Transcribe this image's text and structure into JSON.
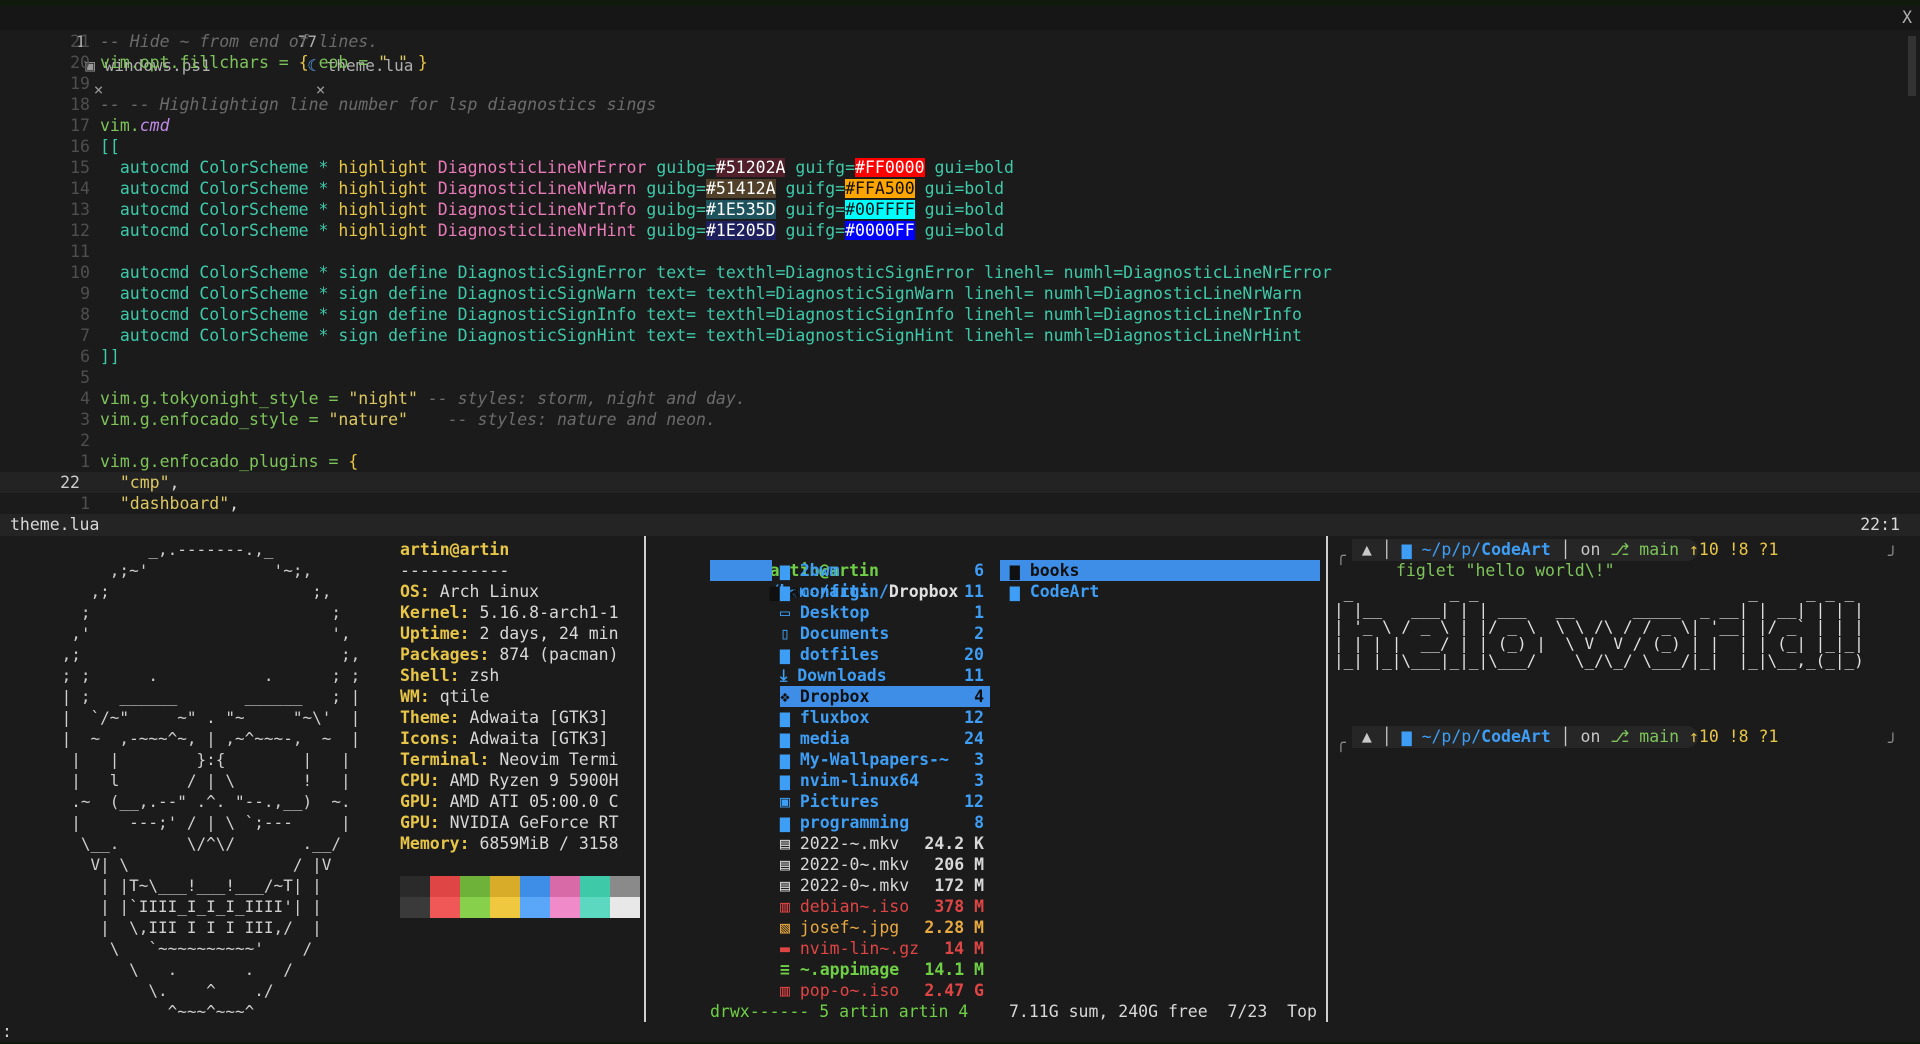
{
  "tabs": [
    {
      "num": "1",
      "icon": "powershell-icon",
      "name": "windows.ps1",
      "close": "×"
    },
    {
      "num": "77",
      "icon": "lua-icon",
      "name": "theme.lua",
      "close": "×"
    }
  ],
  "tabline_close": "X",
  "editor": {
    "lines": [
      {
        "n": "21",
        "comment": "-- Hide ~ from end of lines."
      },
      {
        "n": "20",
        "parts": [
          [
            "vim.opt.fillchars = ",
            "c-green"
          ],
          [
            "{ ",
            "c-yel"
          ],
          [
            "eob = ",
            "c-green"
          ],
          [
            "\" \"",
            "c-str"
          ],
          [
            " }",
            "c-yel"
          ]
        ]
      },
      {
        "n": "19"
      },
      {
        "n": "18",
        "comment": "-- -- Highlightign line number for lsp diagnostics sings"
      },
      {
        "n": "17",
        "parts": [
          [
            "vim.",
            "c-green"
          ],
          [
            "cmd",
            "c-purple"
          ]
        ]
      },
      {
        "n": "16",
        "parts": [
          [
            "[[",
            "c-teal"
          ]
        ]
      },
      {
        "n": "15",
        "hl": [
          "DiagnosticLineNrError",
          "#51202A",
          "#FF0000"
        ]
      },
      {
        "n": "14",
        "hl": [
          "DiagnosticLineNrWarn",
          "#51412A",
          "#FFA500"
        ]
      },
      {
        "n": "13",
        "hl": [
          "DiagnosticLineNrInfo",
          "#1E535D",
          "#00FFFF"
        ]
      },
      {
        "n": "12",
        "hl": [
          "DiagnosticLineNrHint",
          "#1E205D",
          "#0000FF"
        ]
      },
      {
        "n": "11"
      },
      {
        "n": "10",
        "teal": "  autocmd ColorScheme * sign define DiagnosticSignError text= texthl=DiagnosticSignError linehl= numhl=DiagnosticLineNrError"
      },
      {
        "n": "9",
        "teal": "  autocmd ColorScheme * sign define DiagnosticSignWarn text= texthl=DiagnosticSignWarn linehl= numhl=DiagnosticLineNrWarn"
      },
      {
        "n": "8",
        "teal": "  autocmd ColorScheme * sign define DiagnosticSignInfo text= texthl=DiagnosticSignInfo linehl= numhl=DiagnosticLineNrInfo"
      },
      {
        "n": "7",
        "teal": "  autocmd ColorScheme * sign define DiagnosticSignHint text= texthl=DiagnosticSignHint linehl= numhl=DiagnosticLineNrHint"
      },
      {
        "n": "6",
        "parts": [
          [
            "]]",
            "c-teal"
          ]
        ]
      },
      {
        "n": "5"
      },
      {
        "n": "4",
        "parts": [
          [
            "vim.g.tokyonight_style = ",
            "c-green"
          ],
          [
            "\"night\"",
            "c-str"
          ],
          [
            " -- styles: storm, night and day.",
            "c-cm"
          ]
        ]
      },
      {
        "n": "3",
        "parts": [
          [
            "vim.g.enfocado_style = ",
            "c-green"
          ],
          [
            "\"nature\"",
            "c-str"
          ],
          [
            "    -- styles: nature and neon.",
            "c-cm"
          ]
        ]
      },
      {
        "n": "2"
      },
      {
        "n": "1",
        "parts": [
          [
            "vim.g.enfocado_plugins = ",
            "c-green"
          ],
          [
            "{",
            "c-yel"
          ]
        ]
      },
      {
        "n": "22",
        "cur": true,
        "parts": [
          [
            "  \"cmp\"",
            "c-str"
          ],
          [
            ",",
            "c-white"
          ]
        ]
      },
      {
        "n": "1",
        "parts": [
          [
            "  \"dashboard\"",
            "c-str"
          ],
          [
            ",",
            "c-white"
          ]
        ]
      }
    ],
    "hl_words": {
      "autocmd": "autocmd",
      "colorscheme": "ColorScheme",
      "star": "*",
      "highlight": "highlight",
      "guibg": "guibg=",
      "guifg": "guifg=",
      "bold": "gui=bold"
    }
  },
  "statusline": {
    "file": "theme.lua",
    "pos": "22:1"
  },
  "neofetch": {
    "ascii": [
      "          _,.-------.,_",
      "      ,;~'             '~;,",
      "    ,;                     ;,",
      "   ;                         ;",
      "  ,'                         ',",
      " ,;                           ;,",
      " ; ;      .           .      ; ;",
      " | ;   ______       ______   ; |",
      " |  `/~\"     ~\" . \"~     \"~\\'  |",
      " |  ~  ,-~~~^~, | ,~^~~~-,  ~  |",
      "  |   |        }:{        |   |",
      "  |   l       / | \\       !   |",
      "  .~  (__,.--\" .^. \"--.,__)  ~.",
      "  |     ---;' / | \\ `;---     |",
      "   \\__.       \\/^\\/       .__/",
      "    V| \\                 / |V",
      "     | |T~\\___!___!___/~T| |",
      "     | |`IIII_I_I_I_IIII'| |",
      "     |  \\,III I I I III,/  |",
      "      \\   `~~~~~~~~~~'    /",
      "        \\   .       .   /",
      "          \\.    ^    ./",
      "            ^~~~^~~~^"
    ],
    "user": "artin@artin",
    "sep": "-----------",
    "fields": [
      {
        "k": "OS",
        "v": "Arch Linux"
      },
      {
        "k": "Kernel",
        "v": "5.16.8-arch1-1"
      },
      {
        "k": "Uptime",
        "v": "2 days, 24 min"
      },
      {
        "k": "Packages",
        "v": "874 (pacman)"
      },
      {
        "k": "Shell",
        "v": "zsh"
      },
      {
        "k": "WM",
        "v": "qtile"
      },
      {
        "k": "Theme",
        "v": "Adwaita [GTK3]"
      },
      {
        "k": "Icons",
        "v": "Adwaita [GTK3]"
      },
      {
        "k": "Terminal",
        "v": "Neovim Termi"
      },
      {
        "k": "CPU",
        "v": "AMD Ryzen 9 5900H"
      },
      {
        "k": "GPU",
        "v": "AMD ATI 05:00.0 C"
      },
      {
        "k": "GPU",
        "v": "NVIDIA GeForce RT"
      },
      {
        "k": "Memory",
        "v": "6859MiB / 3158"
      }
    ],
    "palette_dark": [
      "#2a2a2a",
      "#e04545",
      "#6fb23a",
      "#d8ac28",
      "#3e8ee8",
      "#d86aa8",
      "#3ec9a9",
      "#8a8a8a"
    ],
    "palette_light": [
      "#3a3a3a",
      "#f05858",
      "#86d04c",
      "#f0c840",
      "#5aa6f8",
      "#f08ac8",
      "#5cd8c0",
      "#e8e8e8"
    ]
  },
  "filemanager": {
    "header_user": "artin@artin",
    "header_path": "/home/artin/",
    "header_dir": "Dropbox",
    "left_sel": "ar~",
    "items": [
      {
        "icon": "folder-icon",
        "name": "2bwm",
        "count": "6"
      },
      {
        "icon": "folder-icon",
        "name": "configs",
        "count": "11"
      },
      {
        "icon": "desktop-icon",
        "name": "Desktop",
        "count": "1"
      },
      {
        "icon": "document-icon",
        "name": "Documents",
        "count": "2"
      },
      {
        "icon": "folder-icon",
        "name": "dotfiles",
        "count": "20"
      },
      {
        "icon": "download-icon",
        "name": "Downloads",
        "count": "11"
      },
      {
        "icon": "dropbox-icon",
        "name": "Dropbox",
        "count": "4",
        "sel": true
      },
      {
        "icon": "folder-icon",
        "name": "fluxbox",
        "count": "12"
      },
      {
        "icon": "folder-icon",
        "name": "media",
        "count": "24"
      },
      {
        "icon": "folder-icon",
        "name": "My-Wallpapers-~",
        "count": "3"
      },
      {
        "icon": "folder-icon",
        "name": "nvim-linux64",
        "count": "3"
      },
      {
        "icon": "pictures-icon",
        "name": "Pictures",
        "count": "12"
      },
      {
        "icon": "folder-icon",
        "name": "programming",
        "count": "8"
      },
      {
        "icon": "video-icon",
        "name": "2022-~.mkv",
        "count": "24.2 K",
        "cls": "fm-file"
      },
      {
        "icon": "video-icon",
        "name": "2022-0~.mkv",
        "count": "206 M",
        "cls": "fm-file"
      },
      {
        "icon": "video-icon",
        "name": "2022-0~.mkv",
        "count": "172 M",
        "cls": "fm-file"
      },
      {
        "icon": "disk-icon",
        "name": "debian~.iso",
        "count": "378 M",
        "cls": "fm-red"
      },
      {
        "icon": "image-icon",
        "name": "josef~.jpg",
        "count": "2.28 M",
        "cls": "fm-orange"
      },
      {
        "icon": "archive-icon",
        "name": "nvim-lin~.gz",
        "count": "14 M",
        "cls": "fm-red"
      },
      {
        "icon": "exec-icon",
        "name": "~.appimage",
        "count": "14.1 M",
        "cls": "fm-green"
      },
      {
        "icon": "disk-icon",
        "name": "pop-o~.iso",
        "count": "2.47 G",
        "cls": "fm-red"
      }
    ],
    "preview": [
      {
        "name": "books",
        "sel": true
      },
      {
        "name": "CodeArt"
      }
    ],
    "footer_perm": "drwx------ 5 artin artin 4",
    "footer_info": "7.11G sum, 240G free  7/23  Top"
  },
  "shell": {
    "prompt_path": "~/p/p/",
    "prompt_dir": "CodeArt",
    "prompt_on": "on",
    "prompt_branch": "main",
    "prompt_git": "↑10 !8 ?1",
    "command": "figlet \"hello world\\!\"",
    "figlet": [
      " _          _ _                            _     _ _ _ ",
      "| |__   ___| | | ___   __      _____  _ __| | __| | | |",
      "| '_ \\ / _ \\ | |/ _ \\  \\ \\ /\\ / / _ \\| '__| |/ _` | | |",
      "| | | |  __/ | | (_) |  \\ V  V / (_) | |  | | (_| |_|_|",
      "|_| |_|\\___|_|_|\\___/    \\_/\\_/ \\___/|_|  |_|\\__,_(_|_)"
    ]
  },
  "cmdline": ":"
}
